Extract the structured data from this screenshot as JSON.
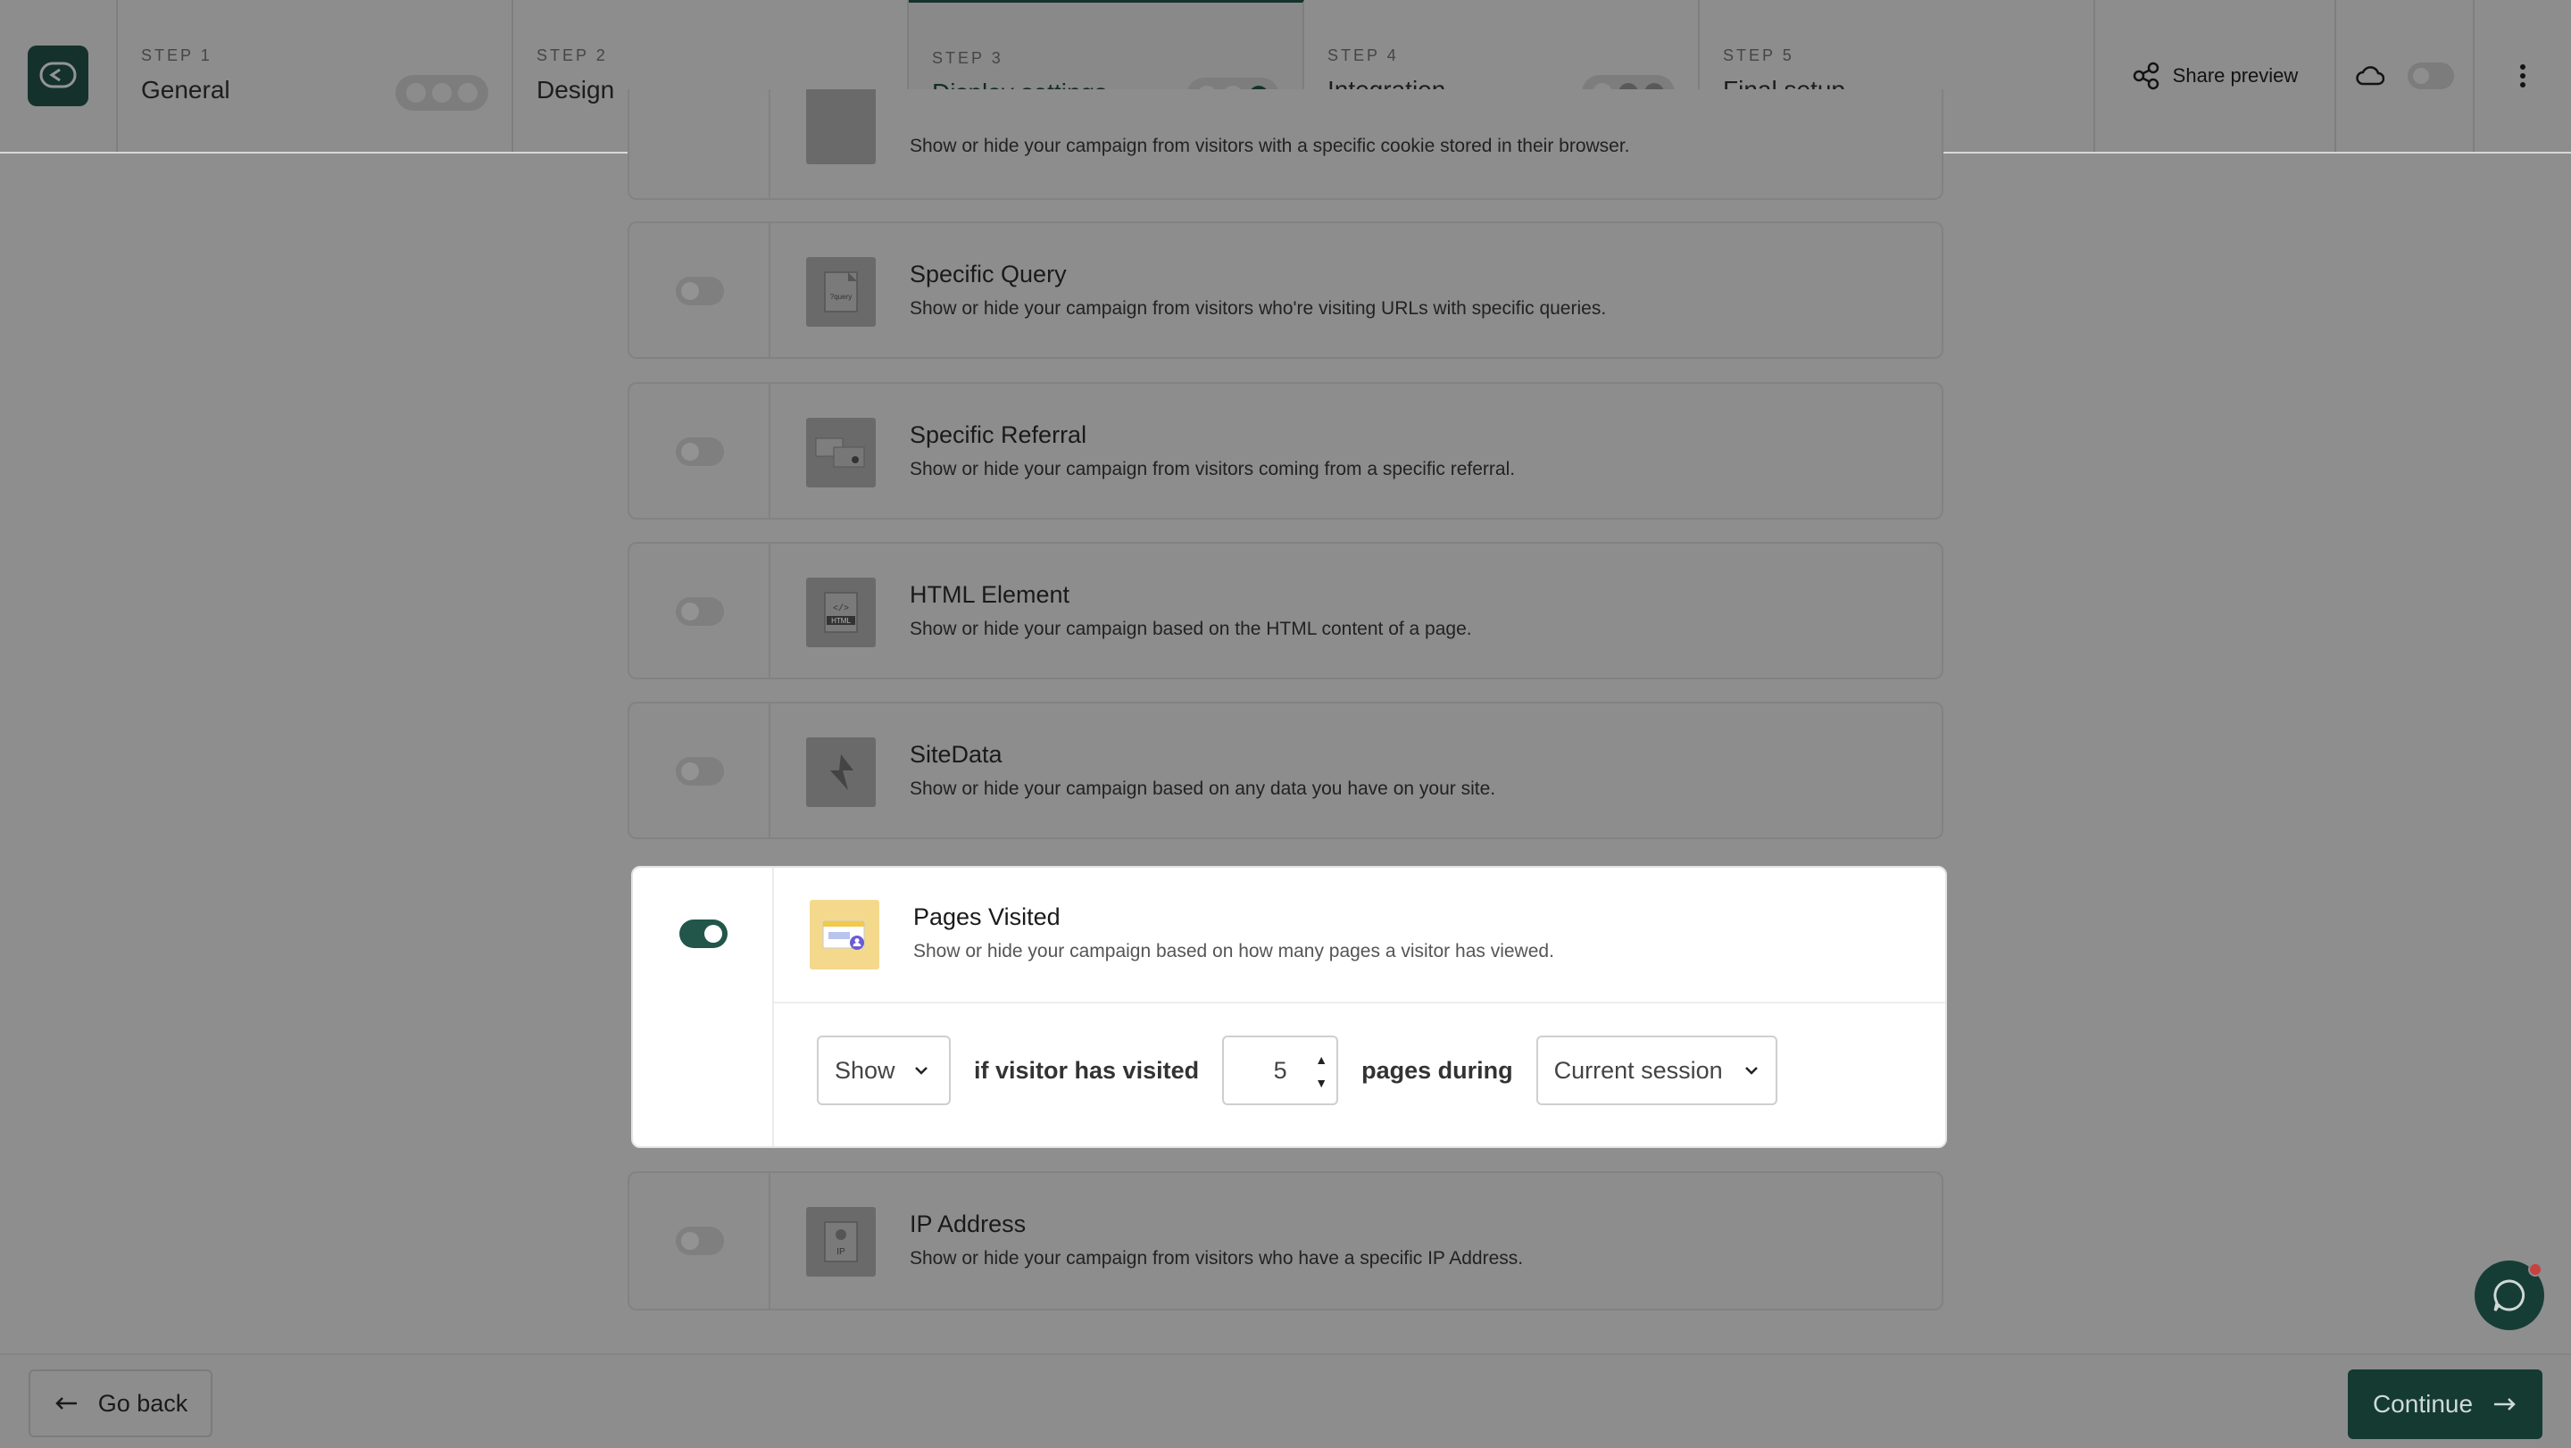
{
  "header": {
    "steps": [
      {
        "num": "STEP 1",
        "title": "General"
      },
      {
        "num": "STEP 2",
        "title": "Design"
      },
      {
        "num": "STEP 3",
        "title": "Display settings"
      },
      {
        "num": "STEP 4",
        "title": "Integration"
      },
      {
        "num": "STEP 5",
        "title": "Final setup"
      }
    ],
    "active_step": 3,
    "share_label": "Share preview"
  },
  "cards": [
    {
      "title": "",
      "desc": "Show or hide your campaign from visitors with a specific cookie stored in their browser.",
      "icon": "cookie-icon",
      "enabled": false
    },
    {
      "title": "Specific Query",
      "desc": "Show or hide your campaign from visitors who're visiting URLs with specific queries.",
      "icon": "query-icon",
      "enabled": false
    },
    {
      "title": "Specific Referral",
      "desc": "Show or hide your campaign from visitors coming from a specific referral.",
      "icon": "referral-icon",
      "enabled": false
    },
    {
      "title": "HTML Element",
      "desc": "Show or hide your campaign based on the HTML content of a page.",
      "icon": "html-icon",
      "enabled": false
    },
    {
      "title": "SiteData",
      "desc": "Show or hide your campaign based on any data you have on your site.",
      "icon": "sitedata-icon",
      "enabled": false
    },
    {
      "title": "Pages Visited",
      "desc": "Show or hide your campaign based on how many pages a visitor has viewed.",
      "icon": "pages-visited-icon",
      "enabled": true
    },
    {
      "title": "IP Address",
      "desc": "Show or hide your campaign from visitors who have a specific IP Address.",
      "icon": "ip-icon",
      "enabled": false
    }
  ],
  "rule": {
    "action": "Show",
    "text1": "if visitor has visited",
    "pages": "5",
    "text2": "pages during",
    "period": "Current session"
  },
  "icon_text": {
    "query": "?query",
    "html": "HTML",
    "ip": "IP"
  },
  "footer": {
    "back_label": "Go back",
    "continue_label": "Continue"
  },
  "colors": {
    "accent": "#23564b",
    "overlay": "#8e8e8e",
    "continue_bg": "#143a32"
  }
}
